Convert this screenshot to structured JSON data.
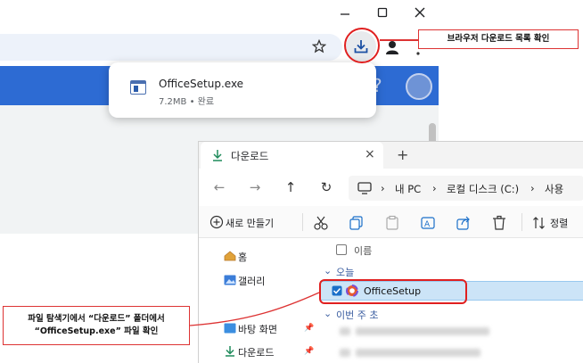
{
  "browser": {
    "download": {
      "filename": "OfficeSetup.exe",
      "meta": "7.2MB • 완료"
    },
    "help_glyph": "?"
  },
  "callouts": {
    "top": "브라우저 다운로드 목록 확인",
    "bottom_line1": "파일 탐색기에서 “다운로드” 폴더에서",
    "bottom_line2": "“OfficeSetup.exe” 파일 확인"
  },
  "explorer": {
    "tab_label": "다운로드",
    "tab_close": "×",
    "tab_add": "+",
    "breadcrumb": [
      "내 PC",
      "로컬 디스크 (C:)",
      "사용"
    ],
    "new_button": "새로 만들기",
    "sort_button": "정렬",
    "sidebar": [
      {
        "label": "홈",
        "icon": "home-icon"
      },
      {
        "label": "갤러리",
        "icon": "gallery-icon"
      },
      {
        "label": "바탕 화면",
        "icon": "desktop-icon"
      },
      {
        "label": "다운로드",
        "icon": "download-icon"
      }
    ],
    "column_name": "이름",
    "group_today": "오늘",
    "group_earlier": "이번 주 초",
    "selected_file": "OfficeSetup"
  },
  "colors": {
    "accent_red": "#e02020",
    "page_header": "#2d6bd3",
    "selection": "#cce4f7"
  }
}
